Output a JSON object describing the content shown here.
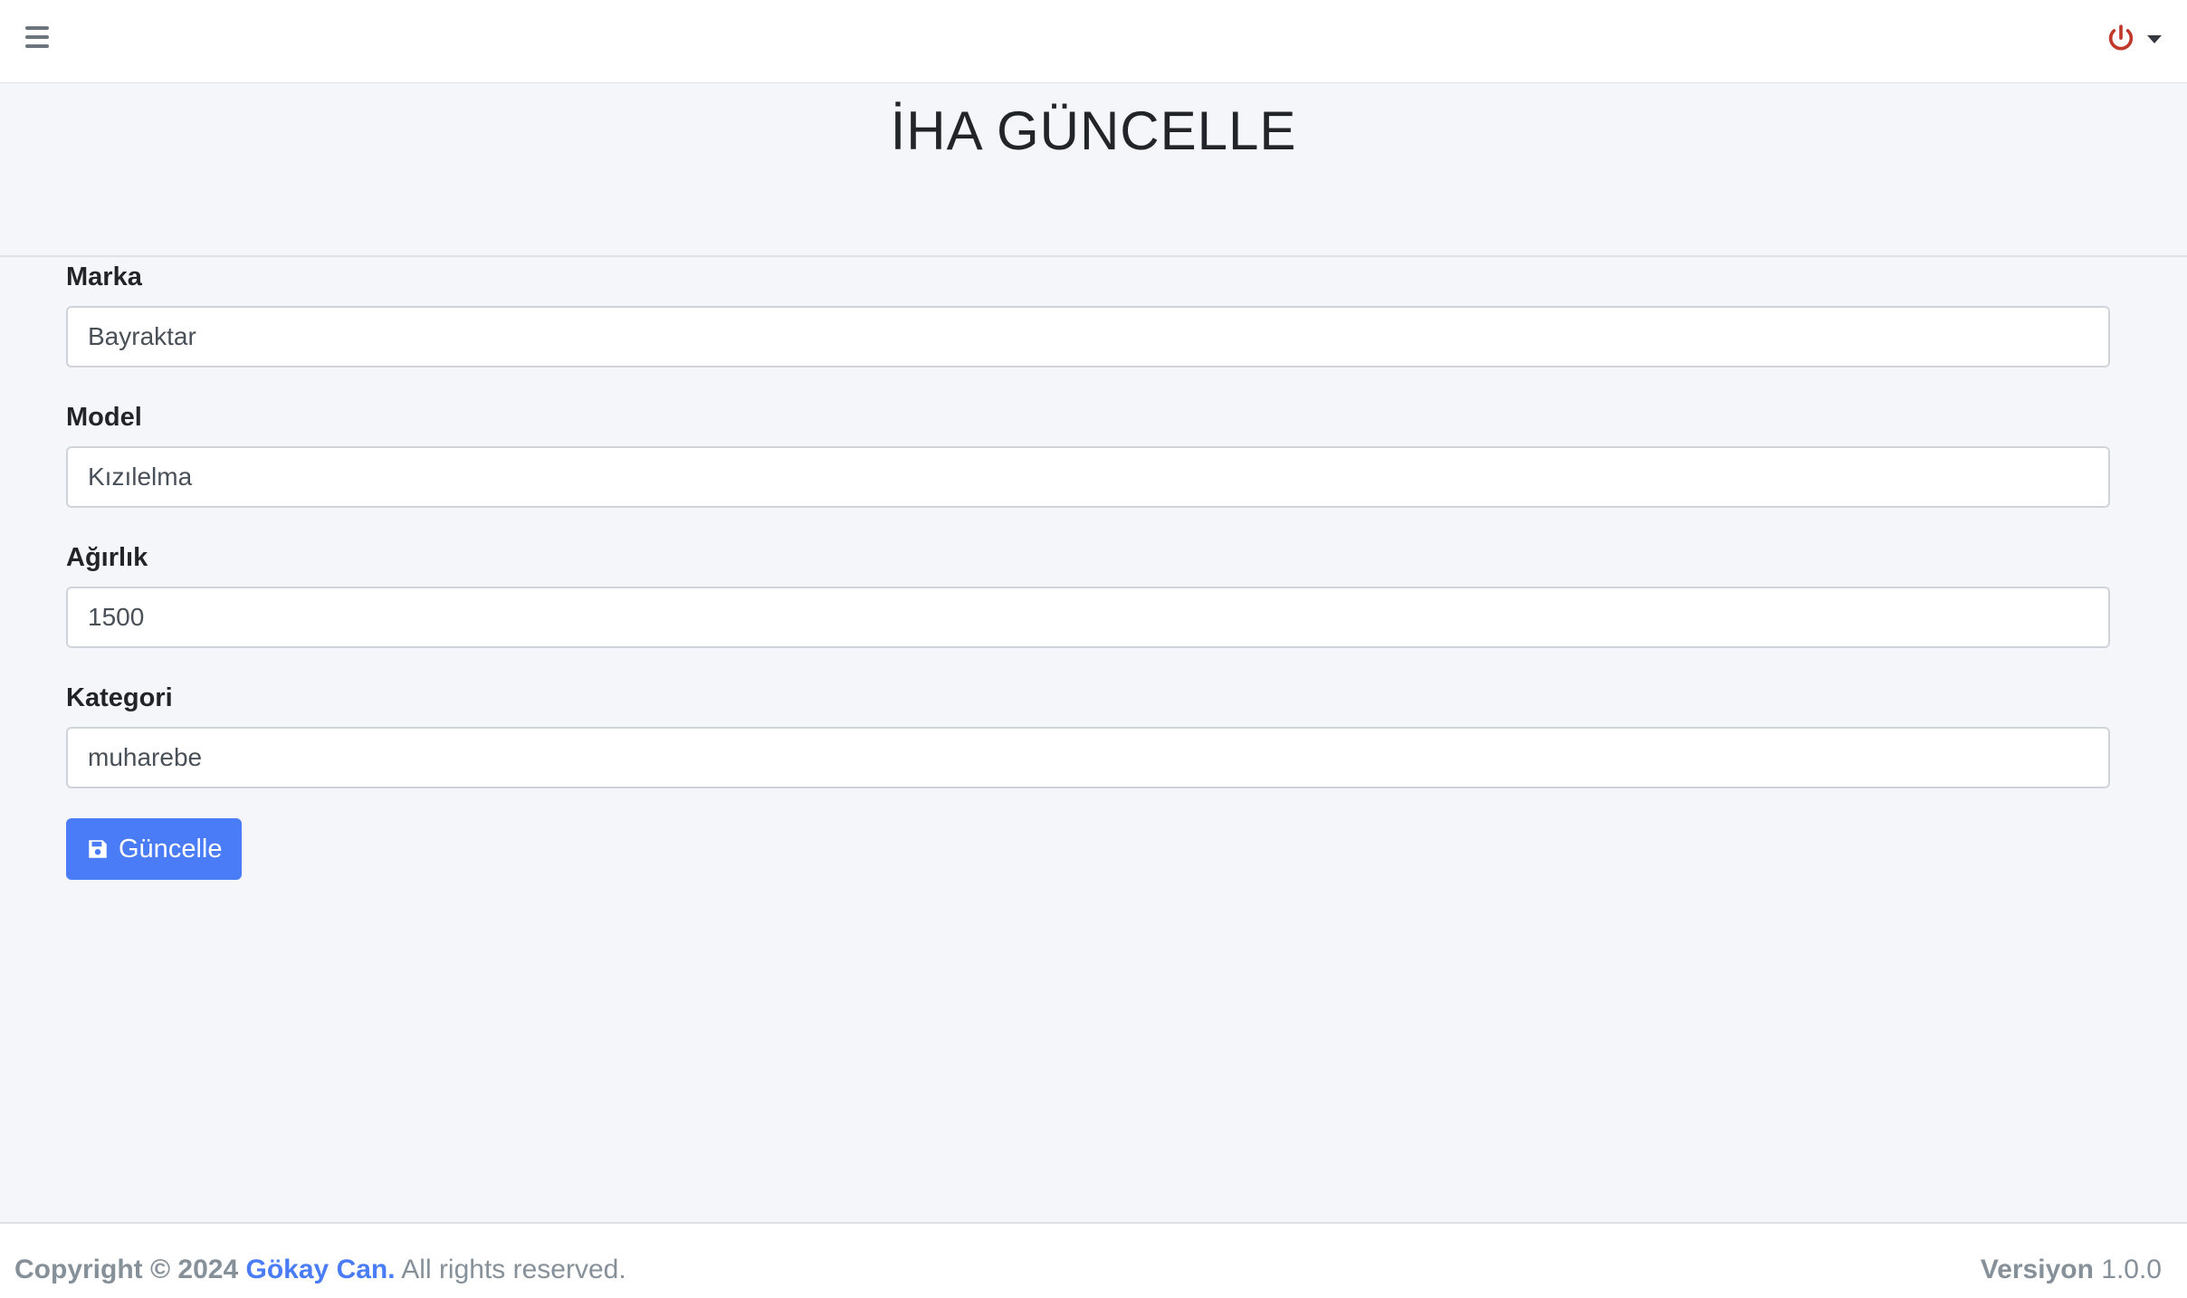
{
  "header": {
    "menu_icon": "hamburger-menu-icon",
    "power_icon": "power-icon",
    "power_color": "#c0392b"
  },
  "page": {
    "title": "İHA GÜNCELLE"
  },
  "form": {
    "fields": [
      {
        "label": "Marka",
        "value": "Bayraktar"
      },
      {
        "label": "Model",
        "value": "Kızılelma"
      },
      {
        "label": "Ağırlık",
        "value": "1500"
      },
      {
        "label": "Kategori",
        "value": "muharebe"
      }
    ],
    "submit_label": "Güncelle",
    "submit_icon": "save-icon",
    "accent_color": "#4a7cf7"
  },
  "footer": {
    "copyright": "Copyright © 2024",
    "author": "Gökay Can.",
    "rights": "All rights reserved.",
    "version_label": "Versiyon",
    "version": "1.0.0"
  }
}
